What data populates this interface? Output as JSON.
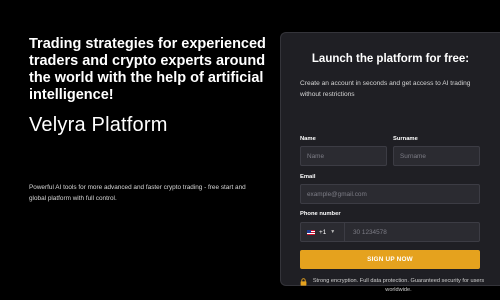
{
  "hero": {
    "headline": "Trading strategies for experienced traders and crypto experts around the world with the help of artificial intelligence!",
    "brand": "Velyra Platform",
    "description": "Powerful AI tools for more advanced and faster crypto trading - free start and global platform with full control."
  },
  "form": {
    "title": "Launch the platform for free:",
    "subtitle": "Create an account in seconds and get access to AI trading without restrictions",
    "name_label": "Name",
    "name_placeholder": "Name",
    "surname_label": "Surname",
    "surname_placeholder": "Surname",
    "email_label": "Email",
    "email_placeholder": "example@gmail.com",
    "phone_label": "Phone number",
    "country_code": "+1",
    "country_flag": "us-flag-icon",
    "phone_placeholder": "30 1234578",
    "submit_label": "SIGN UP NOW",
    "security_note": "Strong encryption. Full data protection. Guaranteed security for users worldwide."
  },
  "colors": {
    "background": "#000000",
    "card": "#1f1f24",
    "accent": "#e5a21e"
  }
}
